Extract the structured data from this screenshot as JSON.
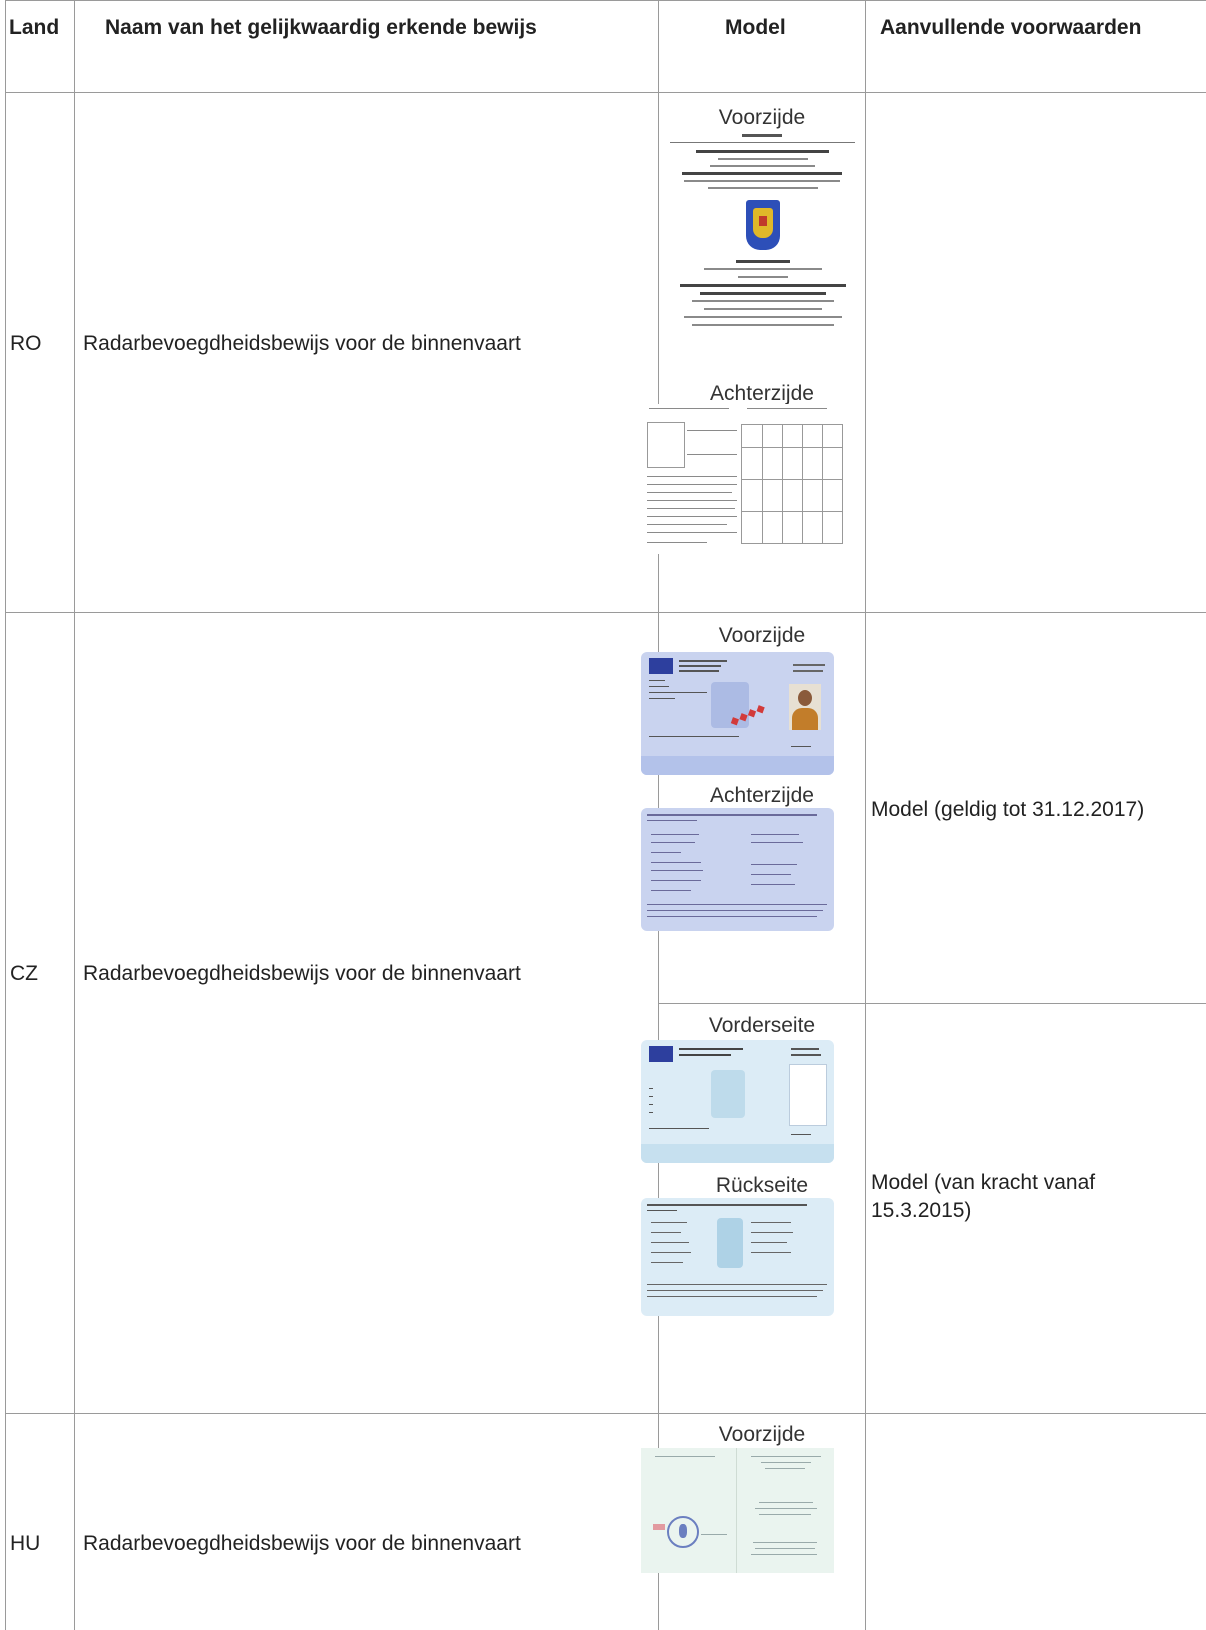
{
  "table": {
    "headers": {
      "land": "Land",
      "name": "Naam van het gelijkwaardig erkende bewijs",
      "model": "Model",
      "conditions": "Aanvullende voorwaarden"
    },
    "rows": [
      {
        "land": "RO",
        "name": "Radarbevoegdheidsbewijs voor de binnenvaart",
        "models": [
          {
            "label_front": "Voorzijde",
            "label_back": "Achterzijde"
          }
        ],
        "conditions": ""
      },
      {
        "land": "CZ",
        "name": "Radarbevoegdheidsbewijs voor de binnenvaart",
        "models": [
          {
            "label_front": "Voorzijde",
            "label_back": "Achterzijde",
            "condition": "Model (geldig tot 31.12.2017)"
          },
          {
            "label_front": "Vorderseite",
            "label_back": "Rückseite",
            "condition": "Model (van kracht vanaf 15.3.2015)"
          }
        ]
      },
      {
        "land": "HU",
        "name": "Radarbevoegdheidsbewijs voor de binnenvaart",
        "models": [
          {
            "label_front": "Voorzijde"
          }
        ],
        "conditions": ""
      }
    ]
  },
  "colors": {
    "border": "#9a9a9a",
    "card_blue": "#c9d3ef",
    "card_light_blue": "#dcecf6",
    "eu_flag": "#2d3f9e",
    "specimen_red": "#d23a3a"
  }
}
